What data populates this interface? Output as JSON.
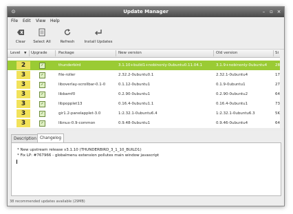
{
  "window": {
    "title": "Update Manager"
  },
  "menu": [
    "File",
    "Edit",
    "View",
    "Help"
  ],
  "toolbar": {
    "clear": "Clear",
    "select_all": "Select All",
    "refresh": "Refresh",
    "install": "Install Updates"
  },
  "columns": {
    "level": "Level",
    "upgrade": "Upgrade",
    "package": "Package",
    "new_version": "New version",
    "old_version": "Old version",
    "size": "Si"
  },
  "rows": [
    {
      "level": "2",
      "package": "thunderbird",
      "new_version": "3.1.10+build1+nobinonly-0ubuntu0.11.04.1",
      "old_version": "3.1.9+nobinonly-0ubuntu4",
      "size": "28",
      "selected": true
    },
    {
      "level": "3",
      "package": "file-roller",
      "new_version": "2.32.2-0ubuntu0.1",
      "old_version": "2.32.1-0ubuntu4",
      "size": "17"
    },
    {
      "level": "3",
      "package": "liboverlay-scrollbar-0.1-0",
      "new_version": "0.1.12-0ubuntu1",
      "old_version": "0.1.9-0ubuntu1",
      "size": "27"
    },
    {
      "level": "3",
      "package": "libbamf0",
      "new_version": "0.2.90-0ubuntu1",
      "old_version": "0.2.90-0ubuntu2",
      "size": "64"
    },
    {
      "level": "3",
      "package": "libpopplet13",
      "new_version": "0.16.4-0ubuntu1.1",
      "old_version": "0.16.4-0ubuntu1",
      "size": "73"
    },
    {
      "level": "3",
      "package": "gir1.2-panelapplet-3.0",
      "new_version": "1:2.32.1-0ubuntu6.4",
      "old_version": "1:2.32.1-0ubuntu6.3",
      "size": "5K"
    },
    {
      "level": "3",
      "package": "libnux-0.9-common",
      "new_version": "0.9.48-0ubuntu1",
      "old_version": "0.9.46-0ubuntu4",
      "size": "64"
    }
  ],
  "tabs": {
    "description": "Description",
    "changelog": "Changelog"
  },
  "changelog": [
    "* New upstream release v3.1.10 (THUNDERBIRD_3_1_10_BUILD1)",
    "* Fix LP: #767966 - globalmenu extension pollutes main window javascript"
  ],
  "status": "38 recommended updates available (29MB)",
  "colors": {
    "selected_row": "#9acb34",
    "level_badge": "#f2e25a",
    "titlebar": "#5a5a5a"
  }
}
